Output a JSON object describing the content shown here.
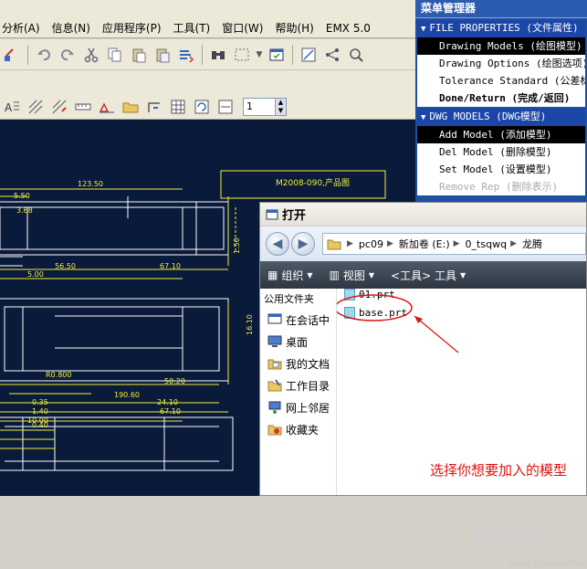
{
  "menubar": {
    "items": [
      "分析(A)",
      "信息(N)",
      "应用程序(P)",
      "工具(T)",
      "窗口(W)",
      "帮助(H)",
      "EMX 5.0"
    ]
  },
  "toolbar": {
    "spinner_value": "1"
  },
  "drawing": {
    "labels": [
      "M2008-090,产品图",
      "5.50",
      "3.68",
      "123.50",
      "56.50",
      "67.10",
      "5.00",
      "R0.800",
      "1.50",
      "16.10",
      "50.20",
      "190.60",
      "24.10",
      "0.35",
      "1.40",
      "10.00",
      "0.40",
      "67.10"
    ]
  },
  "menu_manager": {
    "title": "菜单管理器",
    "sections": [
      {
        "label": "FILE PROPERTIES (文件属性)",
        "items": [
          {
            "label": "Drawing Models (绘图模型)",
            "state": "selected"
          },
          {
            "label": "Drawing Options (绘图选项)",
            "state": "normal"
          },
          {
            "label": "Tolerance Standard (公差标准)",
            "state": "normal"
          },
          {
            "label": "Done/Return (完成/返回)",
            "state": "bold"
          }
        ]
      },
      {
        "label": "DWG MODELS (DWG模型)",
        "items": [
          {
            "label": "Add Model (添加模型)",
            "state": "selected"
          },
          {
            "label": "Del Model (删除模型)",
            "state": "normal"
          },
          {
            "label": "Set Model (设置模型)",
            "state": "normal"
          },
          {
            "label": "Remove Rep (删除表示)",
            "state": "disabled"
          }
        ]
      }
    ]
  },
  "dialog": {
    "title": "打开",
    "address": [
      "pc09",
      "新加卷 (E:)",
      "0_tsqwq",
      "龙腾"
    ],
    "commands": [
      "组织",
      "视图",
      "<工具> 工具"
    ],
    "left_pane_header": "公用文件夹",
    "left_pane": [
      "在会话中",
      "桌面",
      "我的文档",
      "工作目录",
      "网上邻居",
      "收藏夹"
    ],
    "files": [
      "01.prt",
      "base.prt"
    ],
    "annotation": "选择你想要加入的模型",
    "watermark": "野火论坛",
    "watermark_url": "www.proewildfire.cn"
  },
  "colors": {
    "drawing_bg": "#0a1a3a",
    "drawing_line": "#ffffff",
    "dim_yellow": "#f2ee3a",
    "annot_red": "#e01010"
  }
}
